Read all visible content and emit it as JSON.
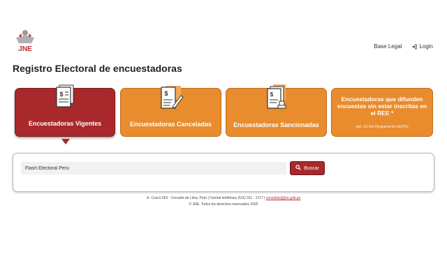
{
  "header": {
    "logo_text": "JNE",
    "nav": {
      "base_legal": "Base Legal",
      "login": "Login"
    }
  },
  "page_title": "Registro Electoral de encuestadoras",
  "cards": [
    {
      "label": "Encuestadoras Vigentes",
      "icon": "document-icon",
      "active": true
    },
    {
      "label": "Encuestadoras Canceladas",
      "icon": "document-edit-icon",
      "active": false
    },
    {
      "label": "Encuestadoras Sancionadas",
      "icon": "document-stamp-icon",
      "active": false
    },
    {
      "label": "Encuestadoras que difunden encuestas sin estar inscritas en el REE *",
      "note": "(art. 50 del Reglamento EEPE)",
      "active": false
    }
  ],
  "search": {
    "value": "Flash Electoral Perú",
    "button_label": "Buscar"
  },
  "footer": {
    "line1_text": "Jr. Cusco 653 - Cercado de Lima, Perú | Central telefónica (511) 311 - 1717 |",
    "line1_email": "consultas@jne.gob.pe",
    "line2": "© JNE. Todos los derechos reservados 2025"
  },
  "colors": {
    "primary_red": "#a8282b",
    "card_orange": "#e88c2e"
  }
}
